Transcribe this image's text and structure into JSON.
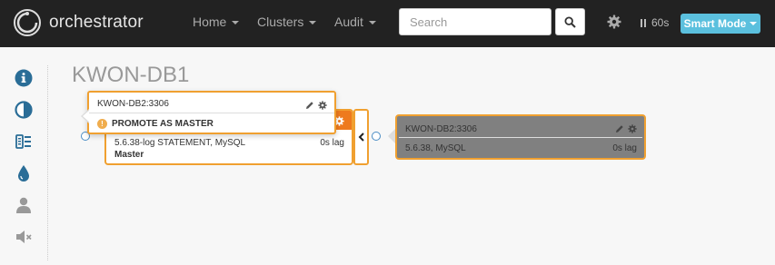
{
  "navbar": {
    "brand": "orchestrator",
    "menu": [
      {
        "label": "Home"
      },
      {
        "label": "Clusters"
      },
      {
        "label": "Audit"
      }
    ],
    "search_placeholder": "Search",
    "refresh_label": "60s",
    "smart_mode_label": "Smart Mode"
  },
  "sidebar": {
    "icons": [
      "info-icon",
      "contrast-icon",
      "list-icon",
      "tint-icon",
      "user-icon",
      "volume-off-icon"
    ],
    "icon_color": "#2a6d97"
  },
  "cluster": {
    "title": "KWON-DB1"
  },
  "popover": {
    "title": "KWON-DB2:3306",
    "action": "PROMOTE AS MASTER"
  },
  "master_node": {
    "version_info": "5.6.38-log STATEMENT, MySQL",
    "lag": "0s lag",
    "role": "Master"
  },
  "replica_node": {
    "title": "KWON-DB2:3306",
    "version_info": "5.6.38, MySQL",
    "lag": "0s lag"
  },
  "colors": {
    "navbar": "#222222",
    "accent_orange": "#ee7a1e",
    "border_orange": "#f0a030",
    "smart_mode": "#5bc0de",
    "replica_bg": "#808080"
  }
}
